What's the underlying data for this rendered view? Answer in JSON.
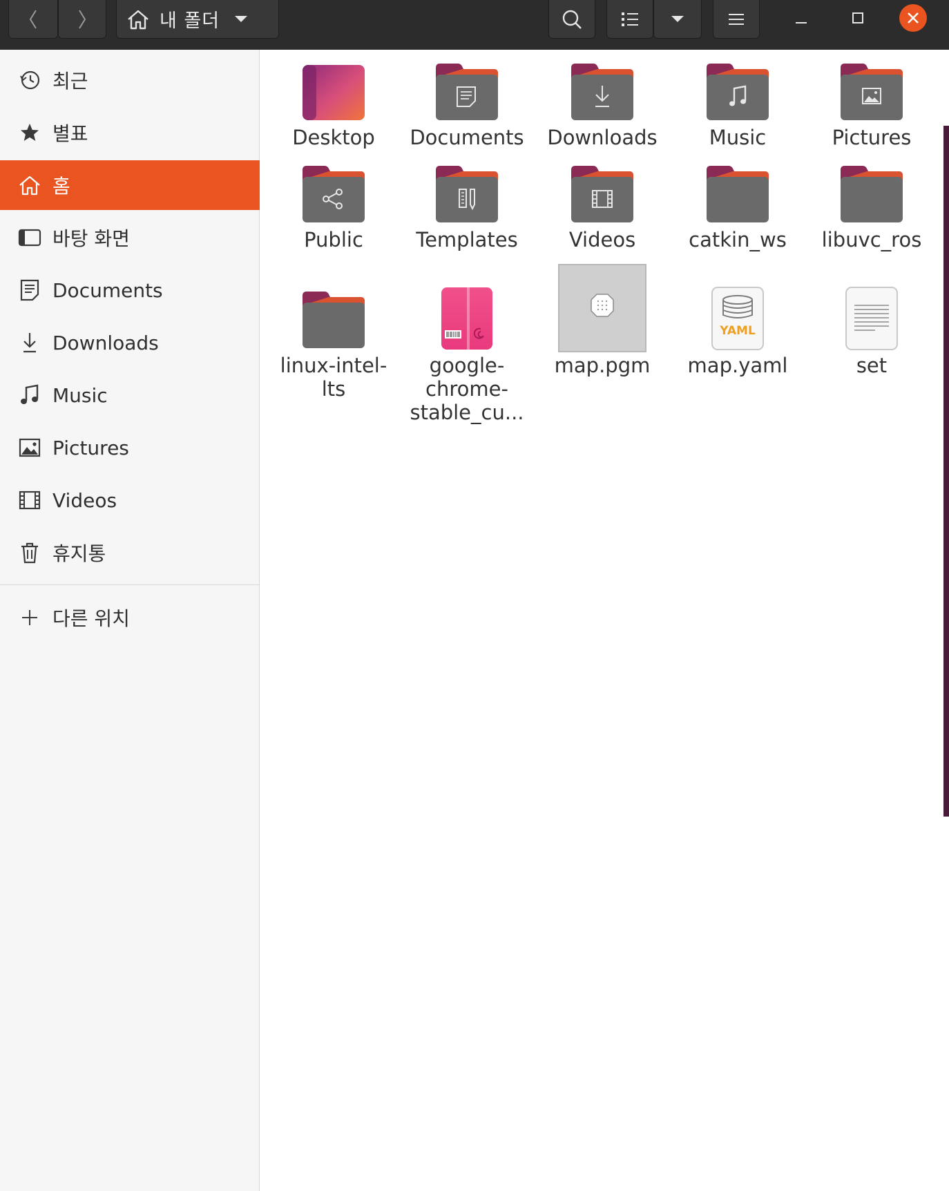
{
  "header": {
    "path_label": "내 폴더",
    "icons": [
      "back-icon",
      "forward-icon",
      "home-icon",
      "dropdown-icon",
      "search-icon",
      "list-view-icon",
      "view-dropdown-icon",
      "menu-icon",
      "minimize-icon",
      "maximize-icon",
      "close-icon"
    ]
  },
  "sidebar": {
    "items": [
      {
        "label": "최근",
        "icon": "recent-icon"
      },
      {
        "label": "별표",
        "icon": "star-icon"
      },
      {
        "label": "홈",
        "icon": "home-icon",
        "active": true
      },
      {
        "label": "바탕 화면",
        "icon": "desktop-icon"
      },
      {
        "label": "Documents",
        "icon": "documents-icon"
      },
      {
        "label": "Downloads",
        "icon": "downloads-icon"
      },
      {
        "label": "Music",
        "icon": "music-icon"
      },
      {
        "label": "Pictures",
        "icon": "pictures-icon"
      },
      {
        "label": "Videos",
        "icon": "videos-icon"
      },
      {
        "label": "휴지통",
        "icon": "trash-icon"
      }
    ],
    "other_locations": {
      "label": "다른 위치",
      "icon": "plus-icon"
    }
  },
  "files": [
    {
      "name": "Desktop",
      "icon": "desktop-folder-icon"
    },
    {
      "name": "Documents",
      "icon": "documents-folder-icon"
    },
    {
      "name": "Downloads",
      "icon": "downloads-folder-icon"
    },
    {
      "name": "Music",
      "icon": "music-folder-icon"
    },
    {
      "name": "Pictures",
      "icon": "pictures-folder-icon"
    },
    {
      "name": "Public",
      "icon": "public-folder-icon"
    },
    {
      "name": "Templates",
      "icon": "templates-folder-icon"
    },
    {
      "name": "Videos",
      "icon": "videos-folder-icon"
    },
    {
      "name": "catkin_ws",
      "icon": "folder-icon"
    },
    {
      "name": "libuvc_ros",
      "icon": "folder-icon"
    },
    {
      "name_lines": [
        "linux-intel-",
        "lts"
      ],
      "icon": "folder-icon"
    },
    {
      "name_lines": [
        "google-",
        "chrome-",
        "stable_cu..."
      ],
      "icon": "deb-package-icon"
    },
    {
      "name": "map.pgm",
      "icon": "image-file-icon"
    },
    {
      "name": "map.yaml",
      "icon": "yaml-file-icon"
    },
    {
      "name": "set",
      "icon": "text-file-icon"
    }
  ],
  "colors": {
    "accent": "#e95420",
    "headerbar": "#2c2c2c",
    "folder_body": "#6a6a6a",
    "folder_tab": "#8a2a55"
  }
}
